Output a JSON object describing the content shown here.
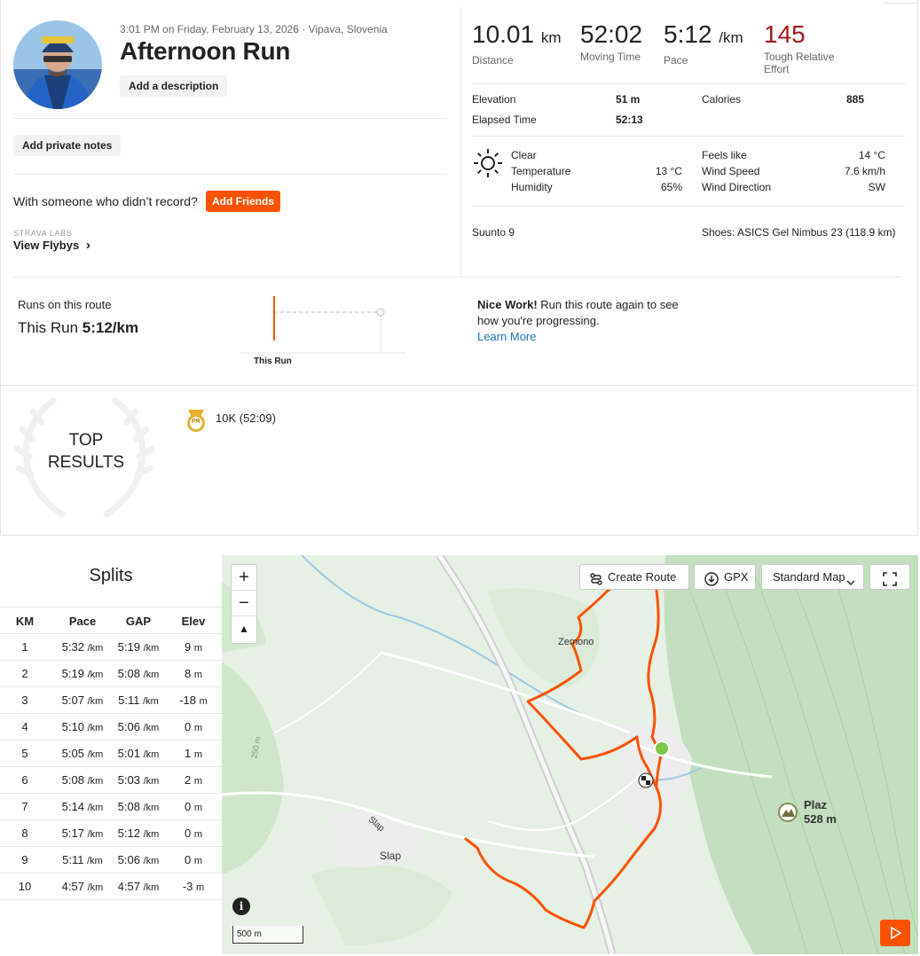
{
  "activity": {
    "meta": "3:01 PM on Friday, February 13, 2026 · Vipava, Slovenia",
    "title": "Afternoon Run",
    "add_description": "Add a description",
    "add_private_notes": "Add private notes",
    "with_someone": "With someone who didn’t record?",
    "add_friends": "Add Friends",
    "labs_label": "STRAVA LABS",
    "view_flybys": "View Flybys",
    "flybys_chevron": "›"
  },
  "stats": {
    "distance_value": "10.01",
    "distance_unit": "km",
    "distance_label": "Distance",
    "moving_time_value": "52:02",
    "moving_time_label": "Moving Time",
    "pace_value": "5:12",
    "pace_unit": "/km",
    "pace_label": "Pace",
    "effort_value": "145",
    "effort_label_1": "Tough Relative",
    "effort_label_2": "Effort",
    "effort_color": "#a41818"
  },
  "details": {
    "elevation_label": "Elevation",
    "elevation_value": "51 m",
    "elapsed_label": "Elapsed Time",
    "elapsed_value": "52:13",
    "calories_label": "Calories",
    "calories_value": "885"
  },
  "weather": {
    "icon": "sun-icon",
    "condition": "Clear",
    "temperature_label": "Temperature",
    "temperature_value": "13 °C",
    "humidity_label": "Humidity",
    "humidity_value": "65%",
    "feels_like_label": "Feels like",
    "feels_like_value": "14 °C",
    "wind_speed_label": "Wind Speed",
    "wind_speed_value": "7.6 km/h",
    "wind_direction_label": "Wind Direction",
    "wind_direction_value": "SW"
  },
  "gear": {
    "device": "Suunto 9",
    "shoes": "Shoes: ASICS Gel Nimbus 23 (118.9 km)"
  },
  "route": {
    "heading": "Runs on this route",
    "this_run_prefix": "This Run",
    "this_run_pace": "5:12/km",
    "chart_label": "This Run",
    "nice_bold": "Nice Work!",
    "nice_text": " Run this route again to see how you're progressing.",
    "learn_more": "Learn More"
  },
  "top_results": {
    "title_line1": "TOP",
    "title_line2": "RESULTS",
    "badge_icon": "pr-medal-icon",
    "badge_text": "PR",
    "result": "10K  (52:09)"
  },
  "splits": {
    "title": "Splits",
    "headers": [
      "KM",
      "Pace",
      "GAP",
      "Elev"
    ],
    "rows": [
      {
        "km": "1",
        "pace": "5:32",
        "pace_unit": "/km",
        "gap": "5:19",
        "gap_unit": "/km",
        "elev": "9",
        "elev_unit": "m"
      },
      {
        "km": "2",
        "pace": "5:19",
        "pace_unit": "/km",
        "gap": "5:08",
        "gap_unit": "/km",
        "elev": "8",
        "elev_unit": "m"
      },
      {
        "km": "3",
        "pace": "5:07",
        "pace_unit": "/km",
        "gap": "5:11",
        "gap_unit": "/km",
        "elev": "-18",
        "elev_unit": "m"
      },
      {
        "km": "4",
        "pace": "5:10",
        "pace_unit": "/km",
        "gap": "5:06",
        "gap_unit": "/km",
        "elev": "0",
        "elev_unit": "m"
      },
      {
        "km": "5",
        "pace": "5:05",
        "pace_unit": "/km",
        "gap": "5:01",
        "gap_unit": "/km",
        "elev": "1",
        "elev_unit": "m"
      },
      {
        "km": "6",
        "pace": "5:08",
        "pace_unit": "/km",
        "gap": "5:03",
        "gap_unit": "/km",
        "elev": "2",
        "elev_unit": "m"
      },
      {
        "km": "7",
        "pace": "5:14",
        "pace_unit": "/km",
        "gap": "5:08",
        "gap_unit": "/km",
        "elev": "0",
        "elev_unit": "m"
      },
      {
        "km": "8",
        "pace": "5:17",
        "pace_unit": "/km",
        "gap": "5:12",
        "gap_unit": "/km",
        "elev": "0",
        "elev_unit": "m"
      },
      {
        "km": "9",
        "pace": "5:11",
        "pace_unit": "/km",
        "gap": "5:06",
        "gap_unit": "/km",
        "elev": "0",
        "elev_unit": "m"
      },
      {
        "km": "10",
        "pace": "4:57",
        "pace_unit": "/km",
        "gap": "4:57",
        "gap_unit": "/km",
        "elev": "-3",
        "elev_unit": "m"
      }
    ]
  },
  "map": {
    "zoom_in": "+",
    "zoom_out": "−",
    "compass": "▲",
    "create_route": "Create Route",
    "gpx": "GPX",
    "map_style": "Standard Map",
    "place_zemono": "Zemono",
    "place_slap": "Slap",
    "place_slap_road": "Slap",
    "contour_label": "250 m",
    "peak_name": "Plaz",
    "peak_elevation": "528 m",
    "scale_label": "500 m",
    "info": "i",
    "route_color": "#fc5200",
    "start_color": "#7ac943"
  }
}
